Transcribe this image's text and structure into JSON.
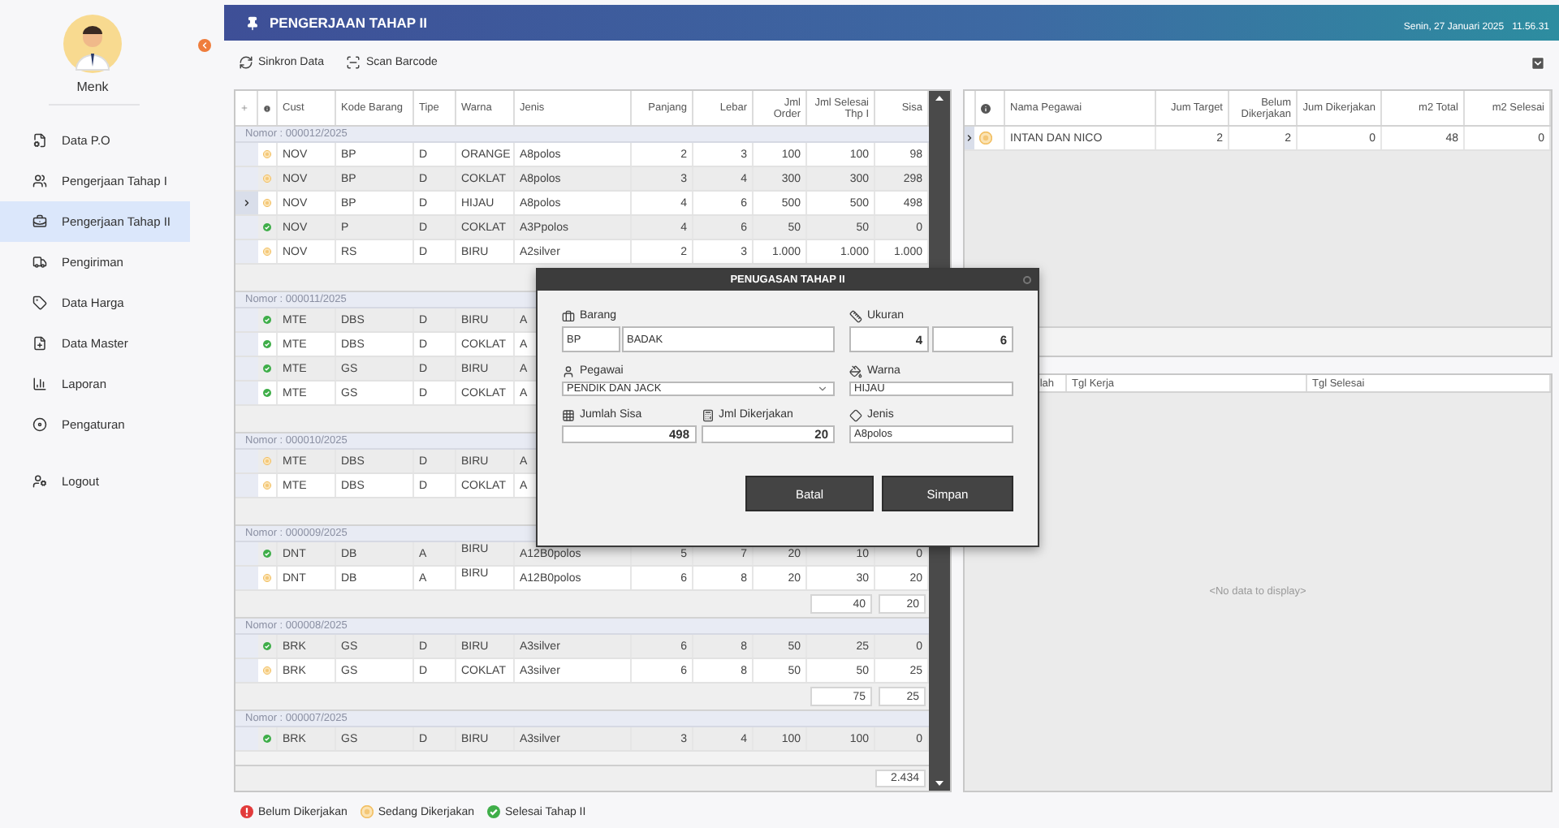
{
  "sidebar": {
    "user_name": "Menk",
    "items": [
      {
        "label": "Data P.O",
        "selected": false
      },
      {
        "label": "Pengerjaan Tahap I",
        "selected": false
      },
      {
        "label": "Pengerjaan Tahap II",
        "selected": true
      },
      {
        "label": "Pengiriman",
        "selected": false
      },
      {
        "label": "Data Harga",
        "selected": false
      },
      {
        "label": "Data Master",
        "selected": false
      },
      {
        "label": "Laporan",
        "selected": false
      },
      {
        "label": "Pengaturan",
        "selected": false
      }
    ],
    "logout": "Logout"
  },
  "header": {
    "title": "PENGERJAAN TAHAP II",
    "date": "Senin, 27 Januari 2025",
    "time": "11.56.31"
  },
  "toolbar": {
    "buttons": [
      "Sinkron Data",
      "Scan Barcode"
    ]
  },
  "orders_grid": {
    "columns": [
      "Cust",
      "Kode Barang",
      "Tipe",
      "Warna",
      "Jenis",
      "Panjang",
      "Lebar",
      "Jml Order",
      "Jml Selesai Thp I",
      "Sisa"
    ],
    "groups": [
      {
        "label": "Nomor : 000012/2025",
        "rows": [
          {
            "kind": "sedang",
            "selected": false,
            "cells": [
              "NOV",
              "BP",
              "D",
              "ORANGE",
              "A8polos",
              "2",
              "3",
              "100",
              "100",
              "98"
            ]
          },
          {
            "kind": "sedang",
            "selected": false,
            "cells": [
              "NOV",
              "BP",
              "D",
              "COKLAT",
              "A8polos",
              "3",
              "4",
              "300",
              "300",
              "298"
            ]
          },
          {
            "kind": "sedang",
            "selected": true,
            "cells": [
              "NOV",
              "BP",
              "D",
              "HIJAU",
              "A8polos",
              "4",
              "6",
              "500",
              "500",
              "498"
            ]
          },
          {
            "kind": "selesai",
            "selected": false,
            "cells": [
              "NOV",
              "P",
              "D",
              "COKLAT",
              "A3Ppolos",
              "4",
              "6",
              "50",
              "50",
              "0"
            ]
          },
          {
            "kind": "sedang",
            "selected": false,
            "cells": [
              "NOV",
              "RS",
              "D",
              "BIRU",
              "A2silver",
              "2",
              "3",
              "1.000",
              "1.000",
              "1.000"
            ]
          }
        ]
      },
      {
        "label": "Nomor : 000011/2025",
        "rows": [
          {
            "kind": "selesai",
            "selected": false,
            "cells": [
              "MTE",
              "DBS",
              "D",
              "BIRU",
              "A"
            ]
          },
          {
            "kind": "selesai",
            "selected": false,
            "cells": [
              "MTE",
              "DBS",
              "D",
              "COKLAT",
              "A"
            ]
          },
          {
            "kind": "selesai",
            "selected": false,
            "cells": [
              "MTE",
              "GS",
              "D",
              "BIRU",
              "A"
            ]
          },
          {
            "kind": "selesai",
            "selected": false,
            "cells": [
              "MTE",
              "GS",
              "D",
              "COKLAT",
              "A"
            ]
          }
        ]
      },
      {
        "label": "Nomor : 000010/2025",
        "rows": [
          {
            "kind": "sedang",
            "selected": false,
            "cells": [
              "MTE",
              "DBS",
              "D",
              "BIRU",
              "A"
            ]
          },
          {
            "kind": "sedang",
            "selected": false,
            "cells": [
              "MTE",
              "DBS",
              "D",
              "COKLAT",
              "A"
            ]
          }
        ]
      },
      {
        "label": "Nomor : 000009/2025",
        "rows": [
          {
            "kind": "selesai",
            "selected": false,
            "cells": [
              "DNT",
              "DB",
              "A",
              "BIRU",
              "A12B0polos",
              "5",
              "7",
              "20",
              "10",
              "0"
            ]
          },
          {
            "kind": "sedang",
            "selected": false,
            "cells": [
              "DNT",
              "DB",
              "A",
              "BIRU",
              "A12B0polos",
              "6",
              "8",
              "20",
              "30",
              "20"
            ]
          }
        ],
        "totals": [
          "40",
          "20"
        ]
      },
      {
        "label": "Nomor : 000008/2025",
        "rows": [
          {
            "kind": "selesai",
            "selected": false,
            "cells": [
              "BRK",
              "GS",
              "D",
              "BIRU",
              "A3silver",
              "6",
              "8",
              "50",
              "25",
              "0"
            ]
          },
          {
            "kind": "sedang",
            "selected": false,
            "cells": [
              "BRK",
              "GS",
              "D",
              "COKLAT",
              "A3silver",
              "6",
              "8",
              "50",
              "50",
              "25"
            ]
          }
        ],
        "totals": [
          "75",
          "25"
        ]
      },
      {
        "label": "Nomor : 000007/2025",
        "rows": [
          {
            "kind": "selesai",
            "selected": false,
            "cells": [
              "BRK",
              "GS",
              "D",
              "BIRU",
              "A3silver",
              "3",
              "4",
              "100",
              "100",
              "0"
            ]
          }
        ]
      }
    ],
    "grand_total": "2.434"
  },
  "employees_grid": {
    "columns": [
      "Nama Pegawai",
      "Jum Target",
      "Belum Dikerjakan",
      "Jum Dikerjakan",
      "m2 Total",
      "m2 Selesai"
    ],
    "rows": [
      {
        "kind": "sedang",
        "selected": true,
        "cells": [
          "INTAN DAN NICO",
          "2",
          "2",
          "0",
          "48",
          "0"
        ]
      }
    ]
  },
  "detail_grid": {
    "columns": [
      "lah",
      "Tgl Kerja",
      "Tgl Selesai"
    ],
    "empty_text": "<No data to display>"
  },
  "dialog": {
    "title": "PENUGASAN TAHAP II",
    "barang": {
      "label": "Barang",
      "code": "BP",
      "name": "BADAK"
    },
    "ukuran": {
      "label": "Ukuran",
      "panjang": "4",
      "lebar": "6"
    },
    "pegawai": {
      "label": "Pegawai",
      "value": "PENDIK DAN JACK"
    },
    "warna": {
      "label": "Warna",
      "value": "HIJAU"
    },
    "jumlah_sisa": {
      "label": "Jumlah Sisa",
      "value": "498"
    },
    "jml_dikerjakan": {
      "label": "Jml Dikerjakan",
      "value": "20"
    },
    "jenis": {
      "label": "Jenis",
      "value": "A8polos"
    },
    "buttons": [
      "Batal",
      "Simpan"
    ]
  },
  "legend": [
    {
      "label": "Belum Dikerjakan",
      "kind": "belum"
    },
    {
      "label": "Sedang Dikerjakan",
      "kind": "sedang"
    },
    {
      "label": "Selesai Tahap II",
      "kind": "selesai"
    }
  ]
}
